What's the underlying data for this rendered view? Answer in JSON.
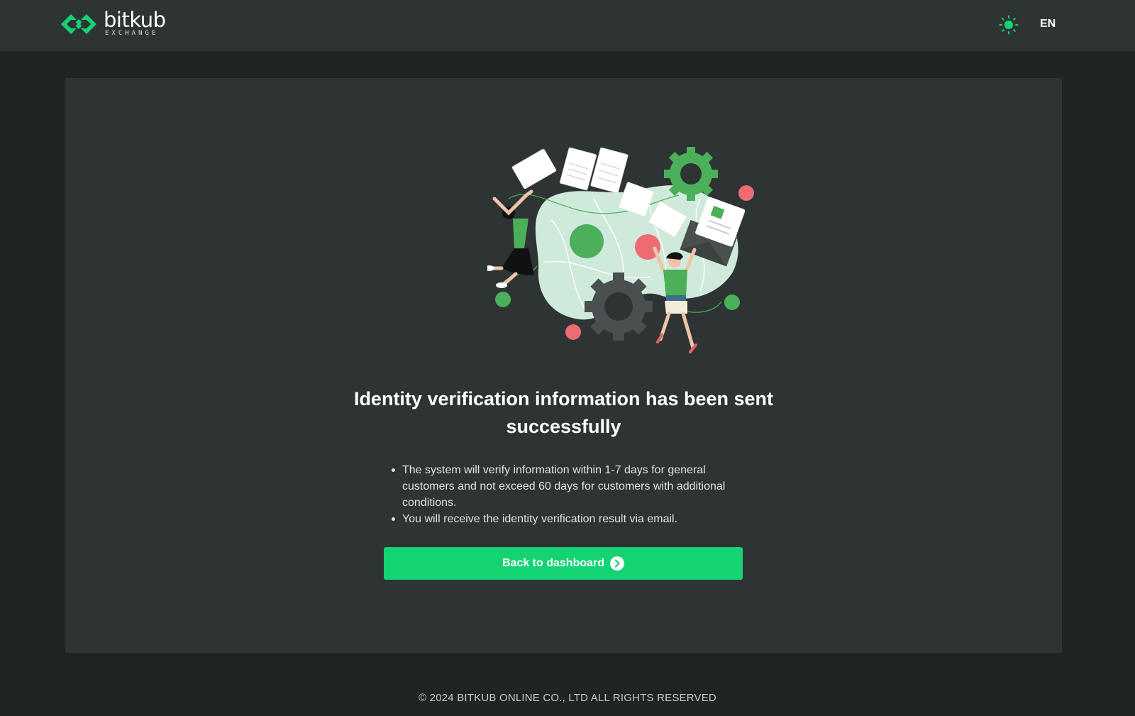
{
  "header": {
    "brand_name": "bitkub",
    "brand_sub": "EXCHANGE",
    "theme_icon": "sun-icon",
    "language": "EN"
  },
  "main": {
    "title": "Identity verification information has been sent successfully",
    "bullets": [
      "The system will verify information within 1-7 days for general customers and not exceed 60 days for customers with additional conditions.",
      "You will receive the identity verification result via email."
    ],
    "cta_label": "Back to dashboard",
    "cta_icon": "chevron-right-circle-icon"
  },
  "footer": {
    "copyright": "© 2024 BITKUB ONLINE CO., LTD ALL RIGHTS RESERVED"
  },
  "colors": {
    "accent": "#13d373",
    "background": "#1f2424",
    "surface": "#2e3434",
    "illustration_green": "#4caf5a",
    "illustration_pink": "#ef6b73"
  }
}
